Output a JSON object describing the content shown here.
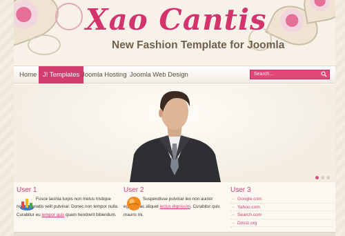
{
  "header": {
    "logo": "Xao Cantis",
    "tagline": "New Fashion Template for Joomla"
  },
  "nav": {
    "items": [
      "Home",
      "J! Templates",
      "Joomla Hosting",
      "Joomla Web Design"
    ],
    "active_index": 1,
    "search_placeholder": "Search..."
  },
  "slideshow": {
    "slide_count": 3,
    "active_slide": 1
  },
  "modules": {
    "user1": {
      "title": "User 1",
      "text": "Fusce lacinia turpis non metus tristique non venenatis velit pulvinar. Donec non tempor nulla. Curabitur eu ",
      "link": "tempor quis",
      "text_after": " quam hendrerit bibendum."
    },
    "user2": {
      "title": "User 2",
      "text": "Suspendisse pulvinar leo non auctor egestas ac aliquet ",
      "link": "lectus dignissim",
      "text_after": ". Curabitur quis mauris mi."
    },
    "user3": {
      "title": "User 3",
      "links": [
        "Google.com",
        "Yahoo.com",
        "Search.com",
        "Dmoz.org"
      ]
    }
  },
  "colors": {
    "accent": "#d23d6d",
    "text": "#3a3028",
    "background": "#f3ede2"
  }
}
